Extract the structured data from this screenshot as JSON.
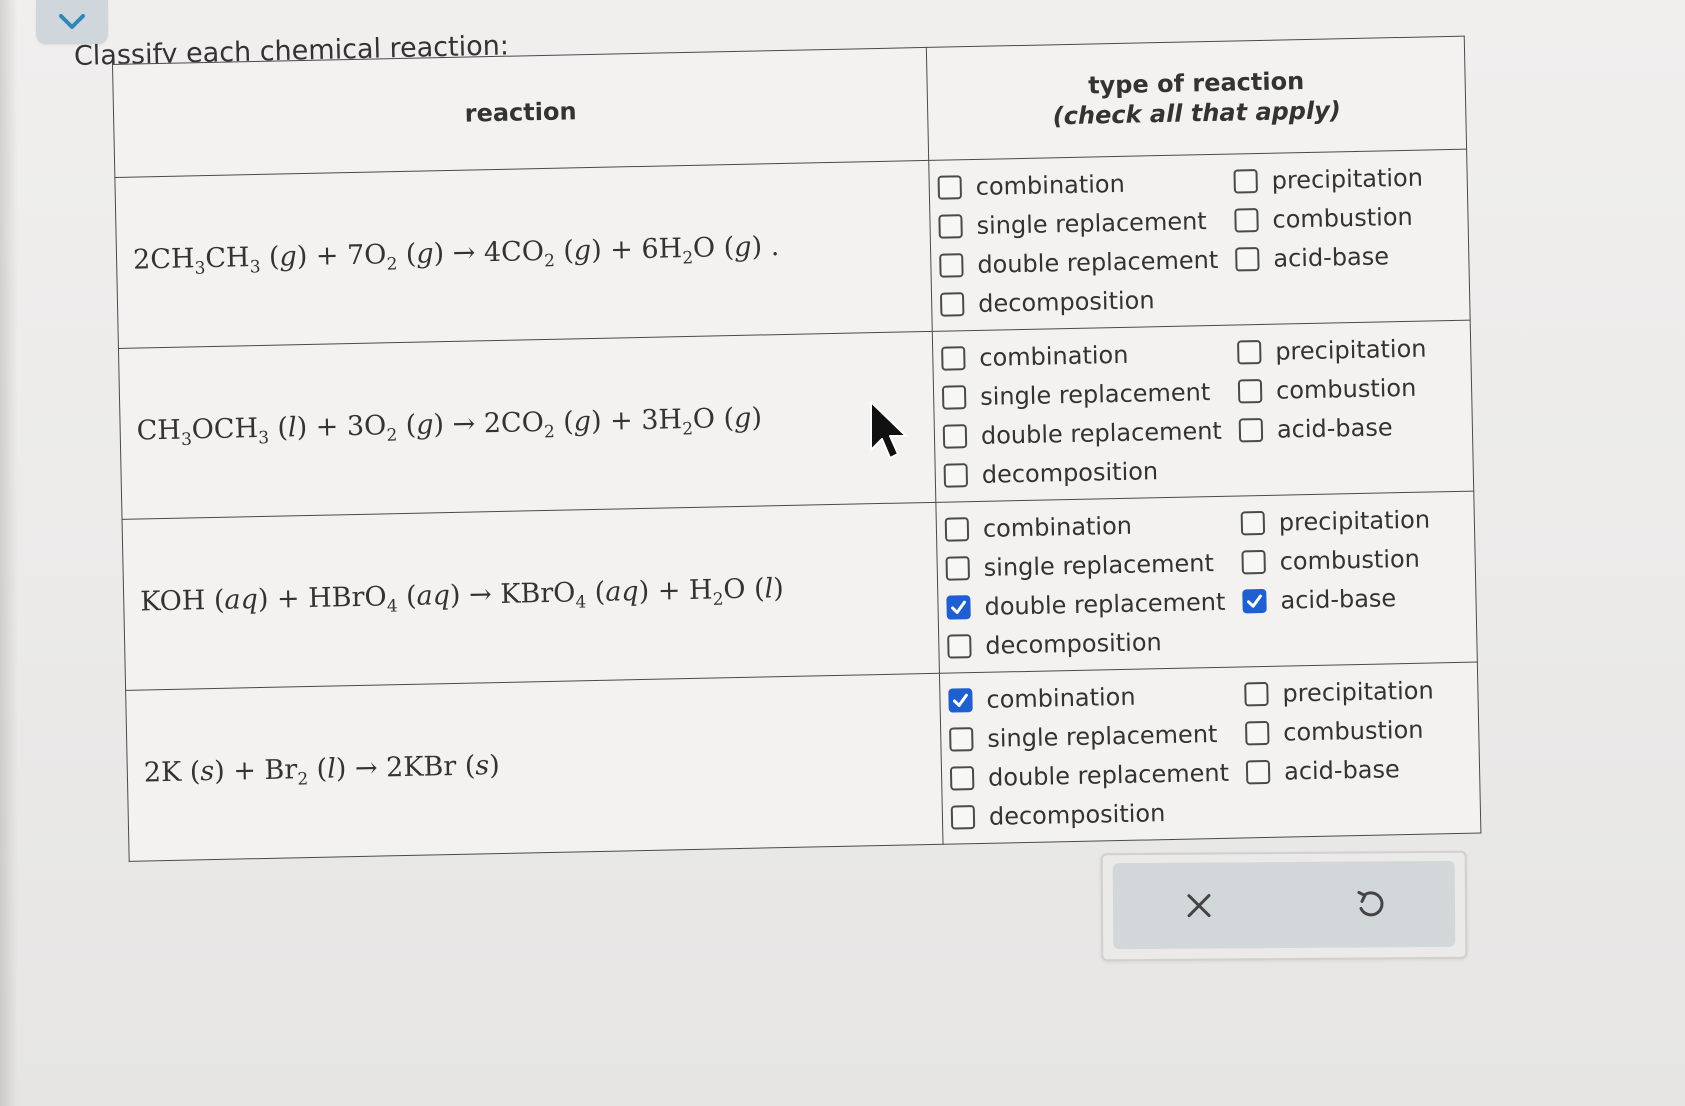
{
  "prompt": {
    "text": "Classify each chemical reaction:"
  },
  "header": {
    "reaction": "reaction",
    "type_line1": "type of reaction",
    "type_line2": "(check all that apply)"
  },
  "options_order": [
    "combination",
    "single replacement",
    "double replacement",
    "decomposition",
    "precipitation",
    "combustion",
    "acid-base"
  ],
  "rows": [
    {
      "equation_html": "2CH<sub>3</sub>CH<sub>3</sub> (<i>g</i>) + 7O<sub>2</sub> (<i>g</i>) → 4CO<sub>2</sub> (<i>g</i>) + 6H<sub>2</sub>O (<i>g</i>) .",
      "options": [
        {
          "label": "combination",
          "checked": false
        },
        {
          "label": "single replacement",
          "checked": false
        },
        {
          "label": "double replacement",
          "checked": false
        },
        {
          "label": "decomposition",
          "checked": false
        },
        {
          "label": "precipitation",
          "checked": false
        },
        {
          "label": "combustion",
          "checked": false
        },
        {
          "label": "acid-base",
          "checked": false
        }
      ]
    },
    {
      "equation_html": "CH<sub>3</sub>OCH<sub>3</sub> (<i>l</i>) + 3O<sub>2</sub> (<i>g</i>) → 2CO<sub>2</sub> (<i>g</i>) + 3H<sub>2</sub>O (<i>g</i>)",
      "options": [
        {
          "label": "combination",
          "checked": false
        },
        {
          "label": "single replacement",
          "checked": false
        },
        {
          "label": "double replacement",
          "checked": false
        },
        {
          "label": "decomposition",
          "checked": false
        },
        {
          "label": "precipitation",
          "checked": false
        },
        {
          "label": "combustion",
          "checked": false
        },
        {
          "label": "acid-base",
          "checked": false
        }
      ]
    },
    {
      "equation_html": "KOH (<i>aq</i>) + HBrO<sub>4</sub> (<i>aq</i>) → KBrO<sub>4</sub> (<i>aq</i>) + H<sub>2</sub>O (<i>l</i>)",
      "options": [
        {
          "label": "combination",
          "checked": false
        },
        {
          "label": "single replacement",
          "checked": false
        },
        {
          "label": "double replacement",
          "checked": true
        },
        {
          "label": "decomposition",
          "checked": false
        },
        {
          "label": "precipitation",
          "checked": false
        },
        {
          "label": "combustion",
          "checked": false
        },
        {
          "label": "acid-base",
          "checked": true
        }
      ]
    },
    {
      "equation_html": "2K (<i>s</i>) + Br<sub>2</sub> (<i>l</i>) → 2KBr (<i>s</i>)",
      "options": [
        {
          "label": "combination",
          "checked": true
        },
        {
          "label": "single replacement",
          "checked": false
        },
        {
          "label": "double replacement",
          "checked": false
        },
        {
          "label": "decomposition",
          "checked": false
        },
        {
          "label": "precipitation",
          "checked": false
        },
        {
          "label": "combustion",
          "checked": false
        },
        {
          "label": "acid-base",
          "checked": false
        }
      ]
    }
  ],
  "actions": {
    "clear_icon": "close-icon",
    "undo_icon": "undo-icon"
  },
  "colors": {
    "check_blue": "#1f5fcf",
    "panel_gray": "#d2d7da",
    "tab_gray": "#cfd7dc"
  }
}
